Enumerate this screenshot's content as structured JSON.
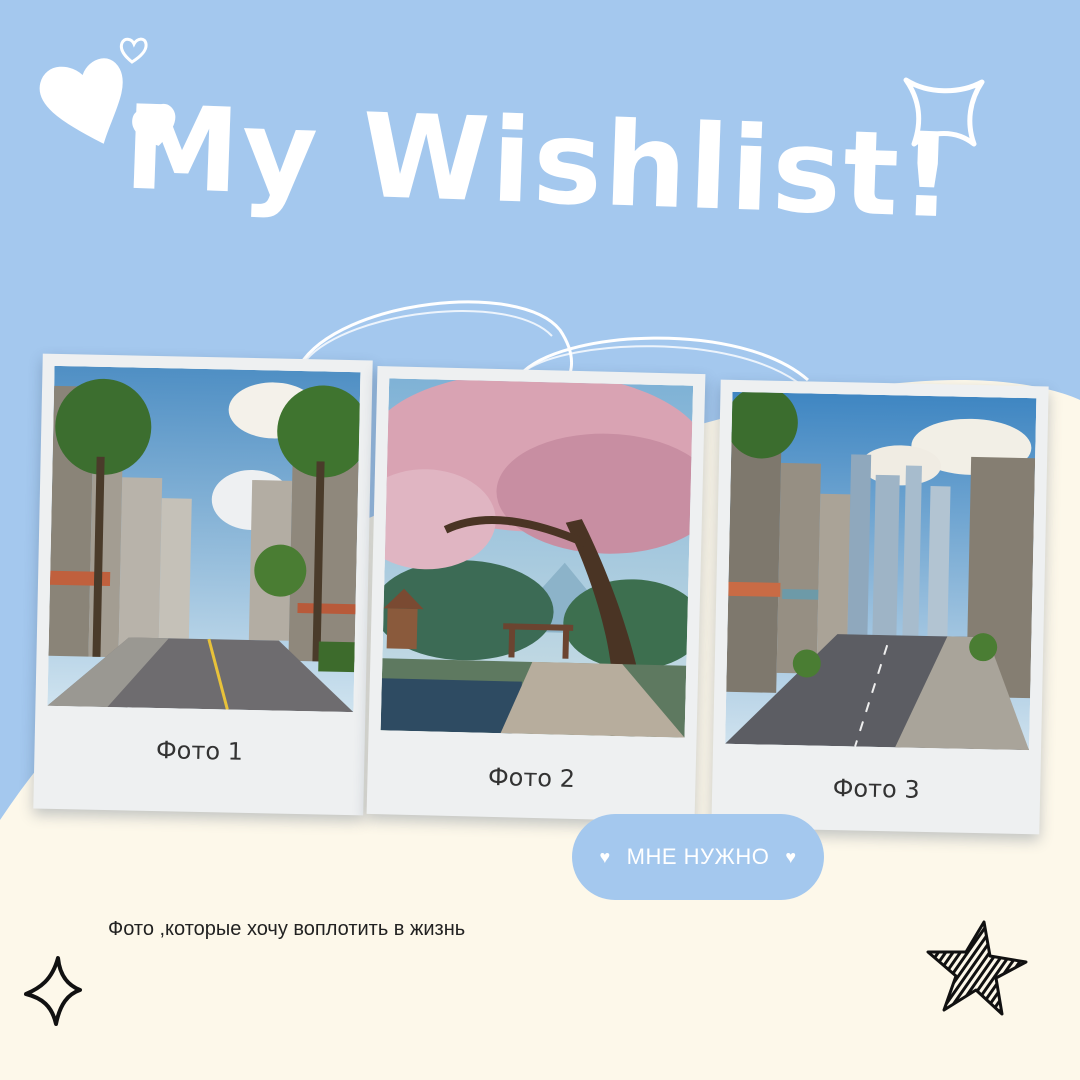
{
  "title": "My Wishlist!",
  "photos": [
    {
      "caption": "Фото 1",
      "scene": "city-street-morning"
    },
    {
      "caption": "Фото 2",
      "scene": "cherry-blossom-park"
    },
    {
      "caption": "Фото 3",
      "scene": "city-street-skyline"
    }
  ],
  "button": {
    "label": "МНЕ НУЖНО",
    "icon_left": "heart-icon",
    "icon_right": "heart-icon"
  },
  "description": "Фото ,которые хочу воплотить в жизнь",
  "colors": {
    "background_blue": "#a4c8ee",
    "cream": "#fdf8ea",
    "text_dark": "#222222",
    "white": "#ffffff"
  }
}
